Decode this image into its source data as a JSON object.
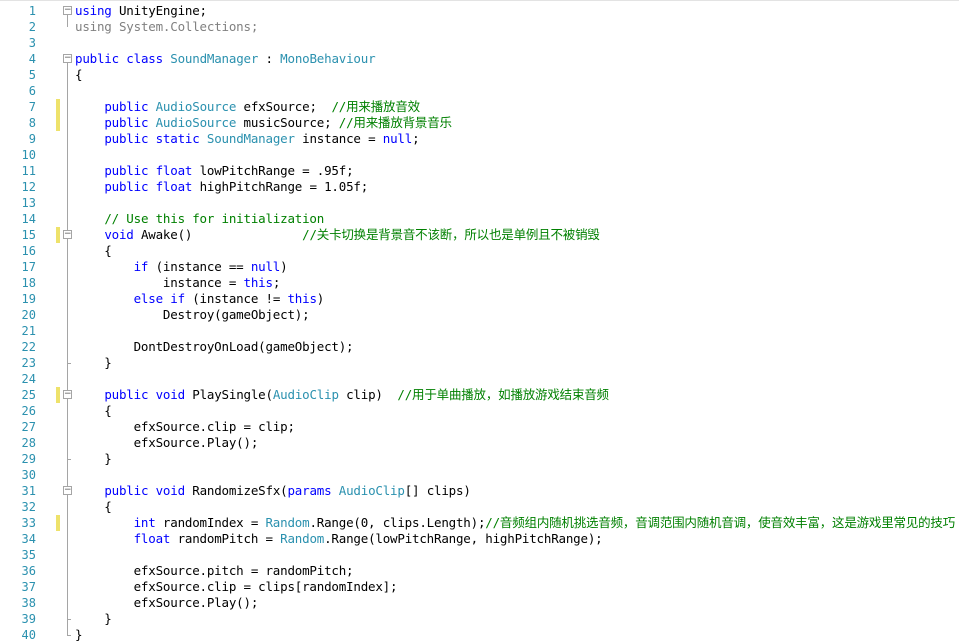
{
  "editor": {
    "lines": [
      {
        "n": "1",
        "tokens": [
          {
            "t": "using",
            "c": "kw"
          },
          {
            "t": " UnityEngine;",
            "c": ""
          }
        ]
      },
      {
        "n": "2",
        "tokens": [
          {
            "t": "using",
            "c": "dim"
          },
          {
            "t": " System.Collections;",
            "c": "dim"
          }
        ]
      },
      {
        "n": "3",
        "tokens": []
      },
      {
        "n": "4",
        "tokens": [
          {
            "t": "public",
            "c": "kw"
          },
          {
            "t": " ",
            "c": ""
          },
          {
            "t": "class",
            "c": "kw"
          },
          {
            "t": " ",
            "c": ""
          },
          {
            "t": "SoundManager",
            "c": "ty"
          },
          {
            "t": " : ",
            "c": ""
          },
          {
            "t": "MonoBehaviour",
            "c": "ty"
          }
        ]
      },
      {
        "n": "5",
        "tokens": [
          {
            "t": "{",
            "c": ""
          }
        ]
      },
      {
        "n": "6",
        "tokens": []
      },
      {
        "n": "7",
        "tokens": [
          {
            "t": "    ",
            "c": ""
          },
          {
            "t": "public",
            "c": "kw"
          },
          {
            "t": " ",
            "c": ""
          },
          {
            "t": "AudioSource",
            "c": "ty"
          },
          {
            "t": " efxSource;  ",
            "c": ""
          },
          {
            "t": "//用来播放音效",
            "c": "cm"
          }
        ]
      },
      {
        "n": "8",
        "tokens": [
          {
            "t": "    ",
            "c": ""
          },
          {
            "t": "public",
            "c": "kw"
          },
          {
            "t": " ",
            "c": ""
          },
          {
            "t": "AudioSource",
            "c": "ty"
          },
          {
            "t": " musicSource; ",
            "c": ""
          },
          {
            "t": "//用来播放背景音乐",
            "c": "cm"
          }
        ]
      },
      {
        "n": "9",
        "tokens": [
          {
            "t": "    ",
            "c": ""
          },
          {
            "t": "public",
            "c": "kw"
          },
          {
            "t": " ",
            "c": ""
          },
          {
            "t": "static",
            "c": "kw"
          },
          {
            "t": " ",
            "c": ""
          },
          {
            "t": "SoundManager",
            "c": "ty"
          },
          {
            "t": " instance = ",
            "c": ""
          },
          {
            "t": "null",
            "c": "kw"
          },
          {
            "t": ";",
            "c": ""
          }
        ]
      },
      {
        "n": "10",
        "tokens": []
      },
      {
        "n": "11",
        "tokens": [
          {
            "t": "    ",
            "c": ""
          },
          {
            "t": "public",
            "c": "kw"
          },
          {
            "t": " ",
            "c": ""
          },
          {
            "t": "float",
            "c": "kw"
          },
          {
            "t": " lowPitchRange = .95f;",
            "c": ""
          }
        ]
      },
      {
        "n": "12",
        "tokens": [
          {
            "t": "    ",
            "c": ""
          },
          {
            "t": "public",
            "c": "kw"
          },
          {
            "t": " ",
            "c": ""
          },
          {
            "t": "float",
            "c": "kw"
          },
          {
            "t": " highPitchRange = 1.05f;",
            "c": ""
          }
        ]
      },
      {
        "n": "13",
        "tokens": []
      },
      {
        "n": "14",
        "tokens": [
          {
            "t": "    ",
            "c": ""
          },
          {
            "t": "// Use this for initialization",
            "c": "cm"
          }
        ]
      },
      {
        "n": "15",
        "tokens": [
          {
            "t": "    ",
            "c": ""
          },
          {
            "t": "void",
            "c": "kw"
          },
          {
            "t": " Awake()               ",
            "c": ""
          },
          {
            "t": "//关卡切换是背景音不该断，所以也是单例且不被销毁",
            "c": "cm"
          }
        ]
      },
      {
        "n": "16",
        "tokens": [
          {
            "t": "    {",
            "c": ""
          }
        ]
      },
      {
        "n": "17",
        "tokens": [
          {
            "t": "        ",
            "c": ""
          },
          {
            "t": "if",
            "c": "kw"
          },
          {
            "t": " (instance == ",
            "c": ""
          },
          {
            "t": "null",
            "c": "kw"
          },
          {
            "t": ")",
            "c": ""
          }
        ]
      },
      {
        "n": "18",
        "tokens": [
          {
            "t": "            instance = ",
            "c": ""
          },
          {
            "t": "this",
            "c": "kw"
          },
          {
            "t": ";",
            "c": ""
          }
        ]
      },
      {
        "n": "19",
        "tokens": [
          {
            "t": "        ",
            "c": ""
          },
          {
            "t": "else",
            "c": "kw"
          },
          {
            "t": " ",
            "c": ""
          },
          {
            "t": "if",
            "c": "kw"
          },
          {
            "t": " (instance != ",
            "c": ""
          },
          {
            "t": "this",
            "c": "kw"
          },
          {
            "t": ")",
            "c": ""
          }
        ]
      },
      {
        "n": "20",
        "tokens": [
          {
            "t": "            Destroy(gameObject);",
            "c": ""
          }
        ]
      },
      {
        "n": "21",
        "tokens": []
      },
      {
        "n": "22",
        "tokens": [
          {
            "t": "        DontDestroyOnLoad(gameObject);",
            "c": ""
          }
        ]
      },
      {
        "n": "23",
        "tokens": [
          {
            "t": "    }",
            "c": ""
          }
        ]
      },
      {
        "n": "24",
        "tokens": []
      },
      {
        "n": "25",
        "tokens": [
          {
            "t": "    ",
            "c": ""
          },
          {
            "t": "public",
            "c": "kw"
          },
          {
            "t": " ",
            "c": ""
          },
          {
            "t": "void",
            "c": "kw"
          },
          {
            "t": " PlaySingle(",
            "c": ""
          },
          {
            "t": "AudioClip",
            "c": "ty"
          },
          {
            "t": " clip)  ",
            "c": ""
          },
          {
            "t": "//用于单曲播放，如播放游戏结束音频",
            "c": "cm"
          }
        ]
      },
      {
        "n": "26",
        "tokens": [
          {
            "t": "    {",
            "c": ""
          }
        ]
      },
      {
        "n": "27",
        "tokens": [
          {
            "t": "        efxSource.clip = clip;",
            "c": ""
          }
        ]
      },
      {
        "n": "28",
        "tokens": [
          {
            "t": "        efxSource.Play();",
            "c": ""
          }
        ]
      },
      {
        "n": "29",
        "tokens": [
          {
            "t": "    }",
            "c": ""
          }
        ]
      },
      {
        "n": "30",
        "tokens": []
      },
      {
        "n": "31",
        "tokens": [
          {
            "t": "    ",
            "c": ""
          },
          {
            "t": "public",
            "c": "kw"
          },
          {
            "t": " ",
            "c": ""
          },
          {
            "t": "void",
            "c": "kw"
          },
          {
            "t": " RandomizeSfx(",
            "c": ""
          },
          {
            "t": "params",
            "c": "kw"
          },
          {
            "t": " ",
            "c": ""
          },
          {
            "t": "AudioClip",
            "c": "ty"
          },
          {
            "t": "[] clips)",
            "c": ""
          }
        ]
      },
      {
        "n": "32",
        "tokens": [
          {
            "t": "    {",
            "c": ""
          }
        ]
      },
      {
        "n": "33",
        "tokens": [
          {
            "t": "        ",
            "c": ""
          },
          {
            "t": "int",
            "c": "kw"
          },
          {
            "t": " randomIndex = ",
            "c": ""
          },
          {
            "t": "Random",
            "c": "ty"
          },
          {
            "t": ".Range(0, clips.Length);",
            "c": ""
          },
          {
            "t": "//音频组内随机挑选音频，音调范围内随机音调，使音效丰富，这是游戏里常见的技巧",
            "c": "cm"
          }
        ]
      },
      {
        "n": "34",
        "tokens": [
          {
            "t": "        ",
            "c": ""
          },
          {
            "t": "float",
            "c": "kw"
          },
          {
            "t": " randomPitch = ",
            "c": ""
          },
          {
            "t": "Random",
            "c": "ty"
          },
          {
            "t": ".Range(lowPitchRange, highPitchRange);",
            "c": ""
          }
        ]
      },
      {
        "n": "35",
        "tokens": []
      },
      {
        "n": "36",
        "tokens": [
          {
            "t": "        efxSource.pitch = randomPitch;",
            "c": ""
          }
        ]
      },
      {
        "n": "37",
        "tokens": [
          {
            "t": "        efxSource.clip = clips[randomIndex];",
            "c": ""
          }
        ]
      },
      {
        "n": "38",
        "tokens": [
          {
            "t": "        efxSource.Play();",
            "c": ""
          }
        ]
      },
      {
        "n": "39",
        "tokens": [
          {
            "t": "    }",
            "c": ""
          }
        ]
      },
      {
        "n": "40",
        "tokens": [
          {
            "t": "}",
            "c": ""
          }
        ]
      }
    ],
    "change_marks": [
      "7",
      "8",
      "15",
      "25",
      "33"
    ],
    "fold_lines": [
      "1",
      "4",
      "15",
      "25",
      "31"
    ],
    "fold_glyph": "−"
  }
}
